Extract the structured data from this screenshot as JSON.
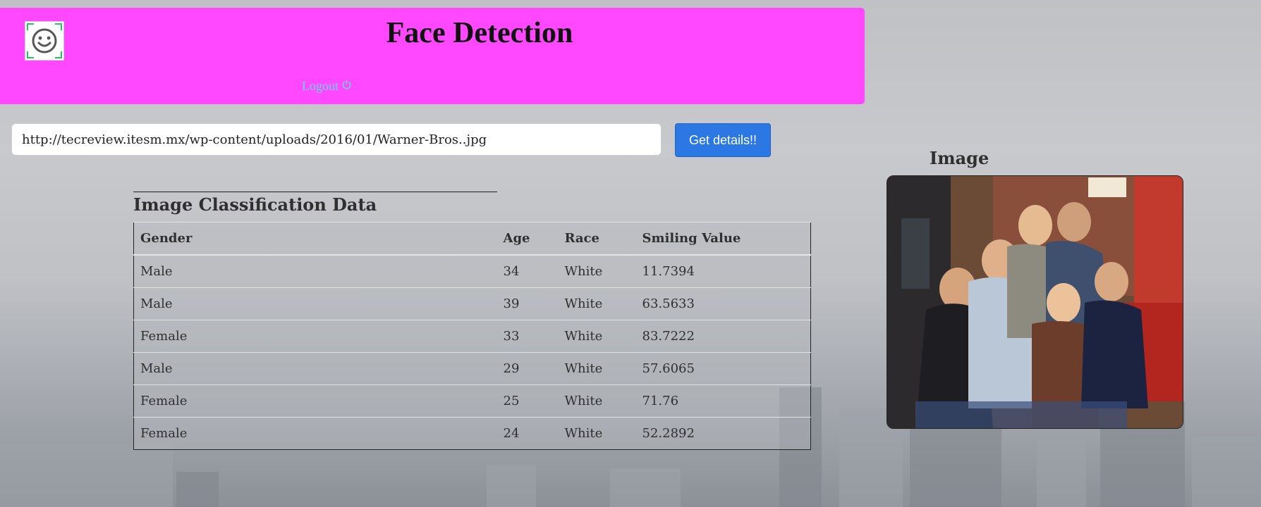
{
  "header": {
    "title": "Face Detection",
    "logout_label": "Logout",
    "logo_icon": "smiley-face-icon",
    "background_color": "#ff48ff"
  },
  "search": {
    "url_value": "http://tecreview.itesm.mx/wp-content/uploads/2016/01/Warner-Bros..jpg",
    "button_label": "Get details!!"
  },
  "classification": {
    "title": "Image Classification Data",
    "columns": [
      "Gender",
      "Age",
      "Race",
      "Smiling Value"
    ],
    "rows": [
      [
        "Male",
        "34",
        "White",
        "11.7394"
      ],
      [
        "Male",
        "39",
        "White",
        "63.5633"
      ],
      [
        "Female",
        "33",
        "White",
        "83.7222"
      ],
      [
        "Male",
        "29",
        "White",
        "57.6065"
      ],
      [
        "Female",
        "25",
        "White",
        "71.76"
      ],
      [
        "Female",
        "24",
        "White",
        "52.2892"
      ]
    ]
  },
  "image_panel": {
    "heading": "Image",
    "photo_icon": "group-photo"
  }
}
